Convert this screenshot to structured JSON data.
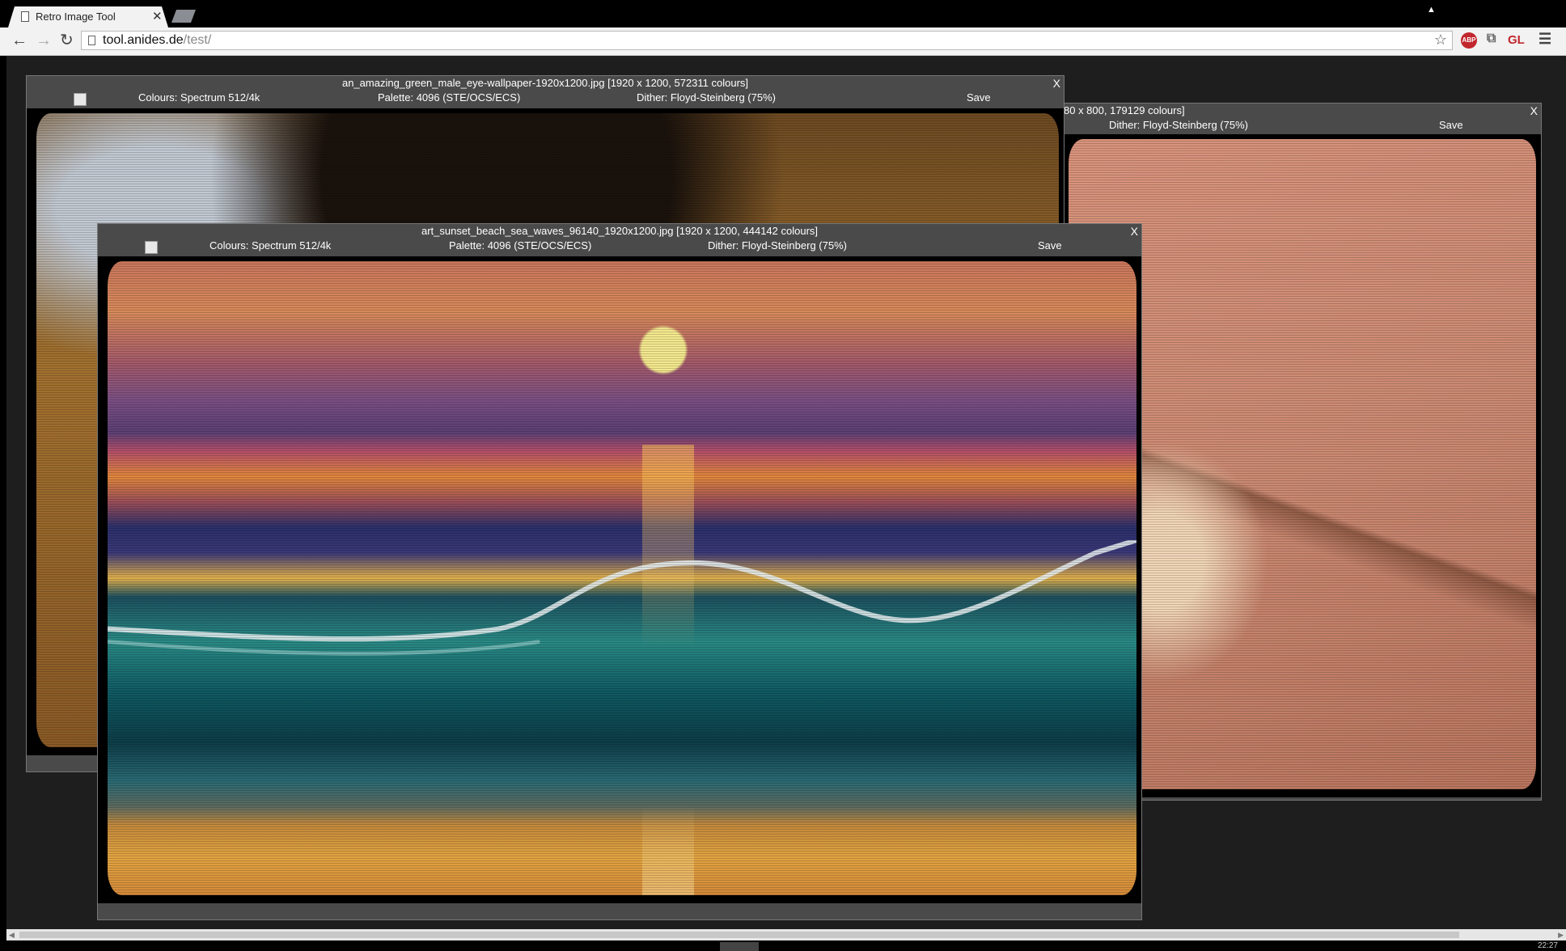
{
  "browser": {
    "tab_title": "Retro Image Tool",
    "tab_close": "✕",
    "url_host": "tool.anides.de",
    "url_path": "/test/",
    "ext_abp": "ABP",
    "ext_gl": "GL"
  },
  "windows": {
    "eye": {
      "title": "an_amazing_green_male_eye-wallpaper-1920x1200.jpg [1920 x 1200, 572311 colours]",
      "close": "X",
      "colours": "Colours: Spectrum 512/4k",
      "palette": "Palette: 4096 (STE/OCS/ECS)",
      "dither": "Dither: Floyd-Steinberg (75%)",
      "save": "Save"
    },
    "flower": {
      "title_partial": "80 x 800, 179129 colours]",
      "close": "X",
      "dither": "Dither: Floyd-Steinberg (75%)",
      "save": "Save"
    },
    "sunset": {
      "title": "art_sunset_beach_sea_waves_96140_1920x1200.jpg [1920 x 1200, 444142 colours]",
      "close": "X",
      "colours": "Colours: Spectrum 512/4k",
      "palette": "Palette: 4096 (STE/OCS/ECS)",
      "dither": "Dither: Floyd-Steinberg (75%)",
      "save": "Save"
    }
  },
  "taskbar": {
    "clock": "22:27"
  }
}
